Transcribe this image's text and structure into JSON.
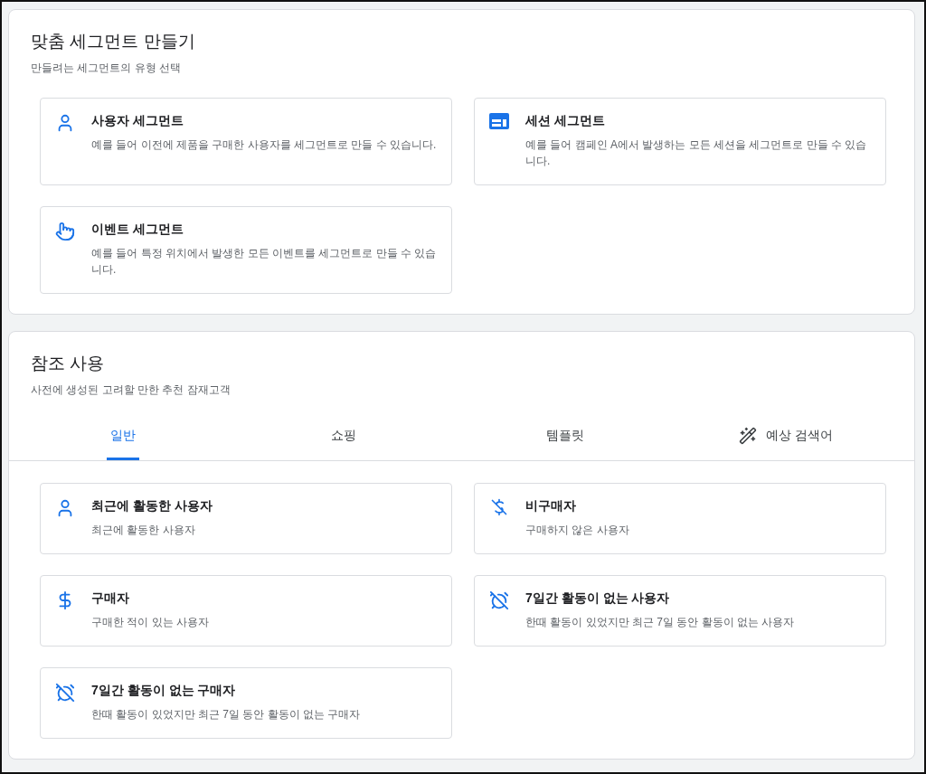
{
  "custom_segment": {
    "title": "맞춤 세그먼트 만들기",
    "subtitle": "만들려는 세그먼트의 유형 선택",
    "cards": [
      {
        "kind": "user",
        "title": "사용자 세그먼트",
        "description": "예를 들어 이전에 제품을 구매한 사용자를 세그먼트로 만들 수 있습니다."
      },
      {
        "kind": "session",
        "title": "세션 세그먼트",
        "description": "예를 들어 캠페인 A에서 발생하는 모든 세션을 세그먼트로 만들 수 있습니다."
      },
      {
        "kind": "event",
        "title": "이벤트 세그먼트",
        "description": "예를 들어 특정 위치에서 발생한 모든 이벤트를 세그먼트로 만들 수 있습니다."
      }
    ]
  },
  "reference": {
    "title": "참조 사용",
    "subtitle": "사전에 생성된 고려할 만한 추천 잠재고객",
    "tabs": [
      {
        "kind": "plain",
        "label": "일반",
        "selected": true
      },
      {
        "kind": "plain",
        "label": "쇼핑",
        "selected": false
      },
      {
        "kind": "plain",
        "label": "템플릿",
        "selected": false
      },
      {
        "kind": "predictive",
        "label": "예상 검색어",
        "selected": false
      }
    ],
    "cards": [
      {
        "kind": "user",
        "title": "최근에 활동한 사용자",
        "description": "최근에 활동한 사용자"
      },
      {
        "kind": "nonpurchaser",
        "title": "비구매자",
        "description": "구매하지 않은 사용자"
      },
      {
        "kind": "purchaser",
        "title": "구매자",
        "description": "구매한 적이 있는 사용자"
      },
      {
        "kind": "inactive",
        "title": "7일간 활동이 없는 사용자",
        "description": "한때 활동이 있었지만 최근 7일 동안 활동이 없는 사용자"
      },
      {
        "kind": "inactive",
        "title": "7일간 활동이 없는 구매자",
        "description": "한때 활동이 있었지만 최근 7일 동안 활동이 없는 구매자"
      }
    ]
  }
}
